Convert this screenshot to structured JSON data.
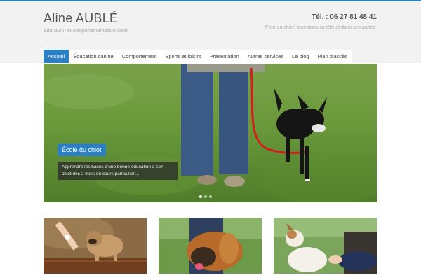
{
  "header": {
    "title": "Aline AUBLÉ",
    "tagline": "Éducateur et comportementaliste canin",
    "phone": "Tél. : 06 27 81 48 41",
    "slogan": "Pour un chien bien dans sa tête et dans ses pattes."
  },
  "nav": {
    "items": [
      {
        "label": "Accueil"
      },
      {
        "label": "Éducation canine"
      },
      {
        "label": "Comportement"
      },
      {
        "label": "Sports et loisirs"
      },
      {
        "label": "Présentation"
      },
      {
        "label": "Autres services"
      },
      {
        "label": "Le blog"
      },
      {
        "label": "Plan d'accès"
      }
    ],
    "active_index": 0
  },
  "slider": {
    "caption_title": "École du chiot",
    "caption_text": "Apprendre les bases d'une bonne éducation à son chiot dès 2 mois en cours particulier....",
    "slide_count": 3,
    "active_slide": 1
  },
  "colors": {
    "accent": "#2c7fc3",
    "header_bg": "#f2f2f2"
  }
}
